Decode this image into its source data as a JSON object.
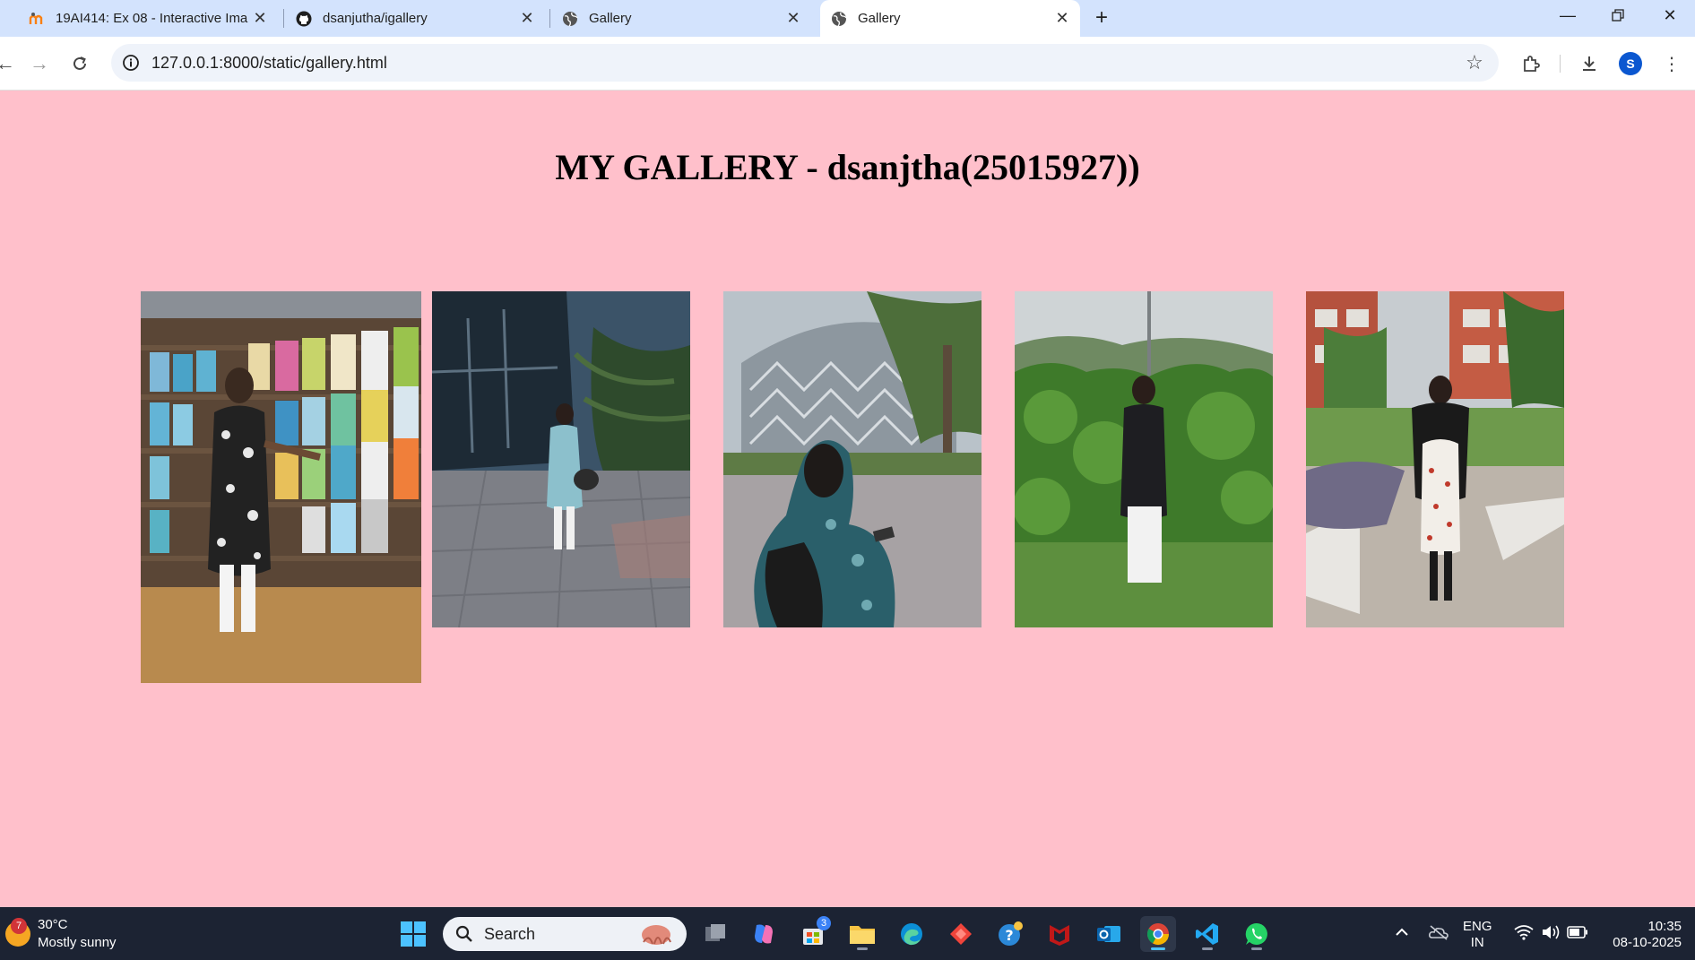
{
  "browser": {
    "tabs": [
      {
        "title": "19AI414: Ex 08 - Interactive Ima",
        "icon": "moodle-icon",
        "active": false
      },
      {
        "title": "dsanjutha/igallery",
        "icon": "github-icon",
        "active": false
      },
      {
        "title": "Gallery",
        "icon": "globe-icon",
        "active": false
      },
      {
        "title": "Gallery",
        "icon": "globe-icon",
        "active": true
      }
    ],
    "url": "127.0.0.1:8000/static/gallery.html",
    "profile_initial": "S"
  },
  "page": {
    "background": "#ffc0cb",
    "title": "MY GALLERY - dsanjtha(25015927))",
    "photos": [
      {
        "name": "photo-bookstore",
        "description_icon": "photo"
      },
      {
        "name": "photo-building-plants",
        "description_icon": "photo"
      },
      {
        "name": "photo-campus-building",
        "description_icon": "photo"
      },
      {
        "name": "photo-garden-bushes",
        "description_icon": "photo"
      },
      {
        "name": "photo-courtyard",
        "description_icon": "photo"
      }
    ]
  },
  "taskbar": {
    "weather": {
      "temp": "30°C",
      "condition": "Mostly sunny",
      "badge": "7"
    },
    "search_placeholder": "Search",
    "store_badge": "3",
    "lang_line1": "ENG",
    "lang_line2": "IN",
    "time": "10:35",
    "date": "08-10-2025"
  }
}
